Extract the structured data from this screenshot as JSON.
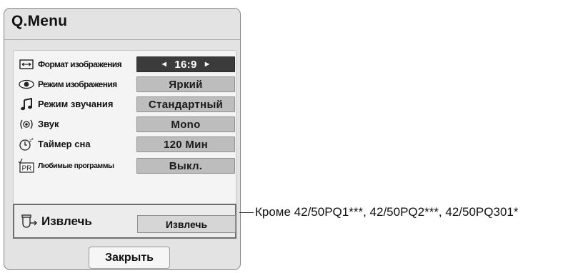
{
  "menu": {
    "title": "Q.Menu",
    "items": [
      {
        "label": "Формат изображения",
        "value": "16:9",
        "icon": "aspect-ratio-icon"
      },
      {
        "label": "Режим изображения",
        "value": "Яркий",
        "icon": "eye-icon"
      },
      {
        "label": "Режим звучания",
        "value": "Стандартный",
        "icon": "music-note-icon"
      },
      {
        "label": "Звук",
        "value": "Mono",
        "icon": "audio-signal-icon"
      },
      {
        "label": "Таймер сна",
        "value": "120 Мин",
        "icon": "sleep-timer-icon"
      },
      {
        "label": "Любимые программы",
        "value": "Выкл.",
        "icon": "favorite-program-icon"
      }
    ],
    "arrows": {
      "left": "◄",
      "right": "►"
    },
    "pr_icon_text": "PR",
    "eject": {
      "label": "Извлечь",
      "button": "Извлечь",
      "icon": "eject-icon"
    },
    "close_button": "Закрыть"
  },
  "callout": {
    "text": "Кроме 42/50PQ1***, 42/50PQ2***, 42/50PQ301*"
  },
  "colors": {
    "panel_bg": "#e3e3e3",
    "selected_value_bg": "#3b3b3b",
    "value_bg": "#bdbdbd"
  }
}
